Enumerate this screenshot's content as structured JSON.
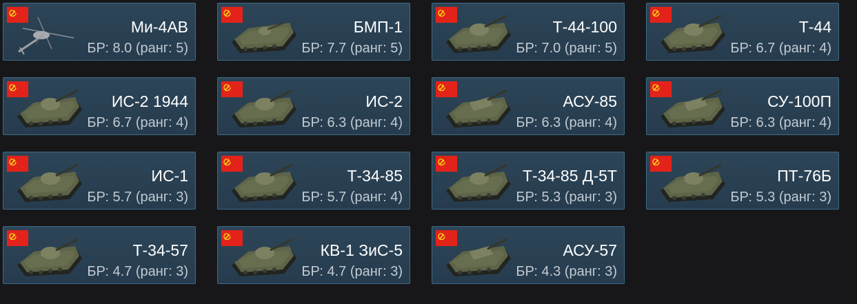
{
  "cards": [
    {
      "name": "Ми-4АВ",
      "br": "БР: 8.0 (ранг: 5)",
      "icon": "helicopter-icon"
    },
    {
      "name": "БМП-1",
      "br": "БР: 7.7 (ранг: 5)",
      "icon": "ifv-icon"
    },
    {
      "name": "Т-44-100",
      "br": "БР: 7.0 (ранг: 5)",
      "icon": "tank-icon"
    },
    {
      "name": "Т-44",
      "br": "БР: 6.7 (ранг: 4)",
      "icon": "tank-icon"
    },
    {
      "name": "ИС-2 1944",
      "br": "БР: 6.7 (ранг: 4)",
      "icon": "heavy-tank-icon"
    },
    {
      "name": "ИС-2",
      "br": "БР: 6.3 (ранг: 4)",
      "icon": "heavy-tank-icon"
    },
    {
      "name": "АСУ-85",
      "br": "БР: 6.3 (ранг: 4)",
      "icon": "tank-destroyer-icon"
    },
    {
      "name": "СУ-100П",
      "br": "БР: 6.3 (ранг: 4)",
      "icon": "spg-icon"
    },
    {
      "name": "ИС-1",
      "br": "БР: 5.7 (ранг: 3)",
      "icon": "heavy-tank-icon"
    },
    {
      "name": "Т-34-85",
      "br": "БР: 5.7 (ранг: 4)",
      "icon": "tank-icon"
    },
    {
      "name": "Т-34-85 Д-5Т",
      "br": "БР: 5.3 (ранг: 3)",
      "icon": "tank-icon"
    },
    {
      "name": "ПТ-76Б",
      "br": "БР: 5.3 (ранг: 3)",
      "icon": "light-tank-icon"
    },
    {
      "name": "Т-34-57",
      "br": "БР: 4.7 (ранг: 3)",
      "icon": "tank-icon"
    },
    {
      "name": "КВ-1 ЗиС-5",
      "br": "БР: 4.7 (ранг: 3)",
      "icon": "heavy-tank-icon"
    },
    {
      "name": "АСУ-57",
      "br": "БР: 4.3 (ранг: 3)",
      "icon": "tank-destroyer-icon"
    }
  ],
  "colors": {
    "card_bg": "#2a4154",
    "card_border": "#3e6a86",
    "page_bg": "#171719",
    "flag_red": "#e3231a",
    "flag_emblem": "#f7d117"
  },
  "flag_icon": "ussr-flag-icon"
}
